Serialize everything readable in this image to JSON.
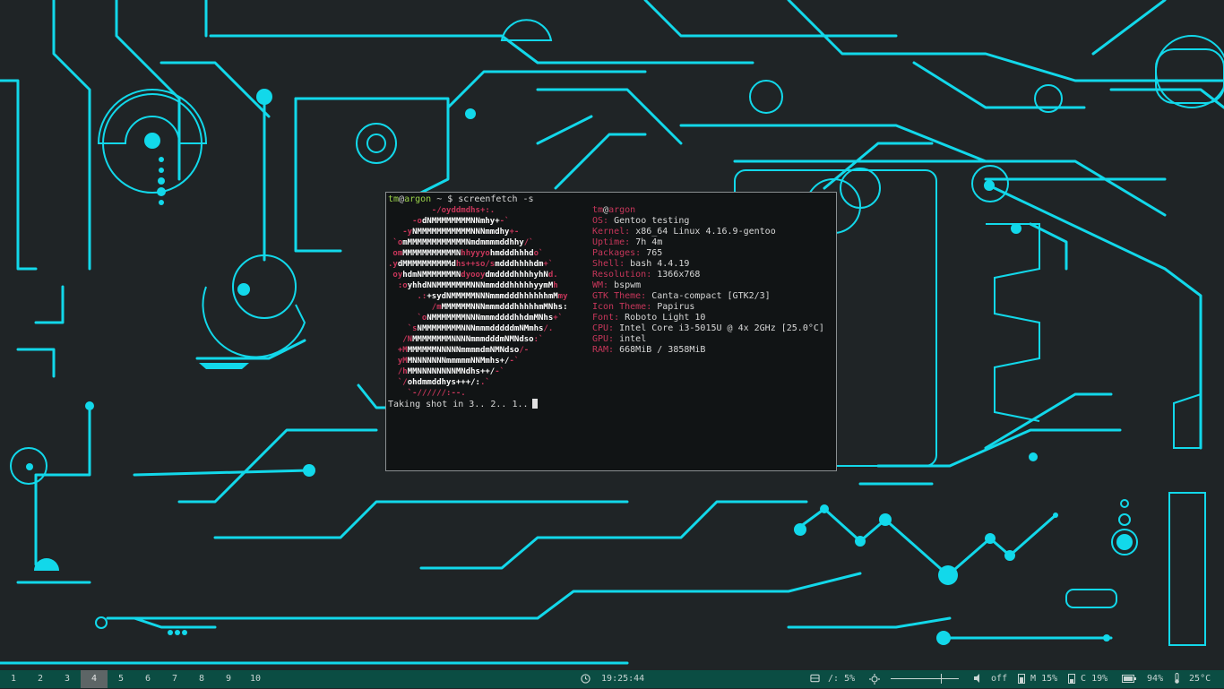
{
  "terminal": {
    "prompt_user": "tm",
    "prompt_at": "@",
    "prompt_host": "argon",
    "prompt_rest": " ~ $ screenfetch -s",
    "logo_lines": [
      [
        "         ",
        "-/oyddmdhs+:.",
        ""
      ],
      [
        "     ",
        "-o",
        "dNMMMMMMMMNNmhy+",
        "-`"
      ],
      [
        "   ",
        "-y",
        "NMMMMMMMMMMMNNNmmdhy",
        "+-"
      ],
      [
        " ",
        "`o",
        "mMMMMMMMMMMMMNmdmmmmddhhy",
        "/`"
      ],
      [
        " ",
        "om",
        "MMMMMMMMMMMN",
        "hhyyyo",
        "hmdddhhhd",
        "o`"
      ],
      [
        "",
        ".y",
        "dMMMMMMMMMMd",
        "hs++so/s",
        "mdddhhhhdm",
        "+`"
      ],
      [
        " ",
        "oy",
        "hdmNMMMMMMMN",
        "dyooy",
        "dmddddhhhhyhN",
        "d."
      ],
      [
        "  ",
        ":o",
        "yhhdNNMMMMMMMNNNmmdddhhhhhyymM",
        "h"
      ],
      [
        "      ",
        ".:",
        "+sydNMMMMMNNNmmmdddhhhhhhmM",
        "my"
      ],
      [
        "         ",
        "/m",
        "MMMMMMNNNmmmdddhhhhhmMNhs:",
        ""
      ],
      [
        "      ",
        "`o",
        "NMMMMMMMNNNmmmddddhhdmMNhs",
        "+`"
      ],
      [
        "    ",
        "`s",
        "NMMMMMMMMNNNmmmdddddmNMmhs",
        "/."
      ],
      [
        "   ",
        "/N",
        "MMMMMMMMNNNNmmmdddmNMNdso",
        ":`"
      ],
      [
        "  ",
        "+M",
        "MMMMMMNNNNNmmmmdmNMNdso",
        "/-"
      ],
      [
        "  ",
        "yM",
        "MNNNNNNNmmmmmNNMmhs+/",
        "-`"
      ],
      [
        "  ",
        "/h",
        "MMNNNNNNNNMNdhs++/",
        "-`"
      ],
      [
        "  ",
        "`/",
        "ohdmmddhys+++/:",
        ".`"
      ],
      [
        "    ",
        "`-//////:--.",
        "",
        ""
      ]
    ],
    "info_user": "tm",
    "info_at": "@",
    "info_host": "argon",
    "info": [
      {
        "key": "OS:",
        "value": "Gentoo testing"
      },
      {
        "key": "Kernel:",
        "value": "x86_64 Linux 4.16.9-gentoo"
      },
      {
        "key": "Uptime:",
        "value": "7h 4m"
      },
      {
        "key": "Packages:",
        "value": "765"
      },
      {
        "key": "Shell:",
        "value": "bash 4.4.19"
      },
      {
        "key": "Resolution:",
        "value": "1366x768"
      },
      {
        "key": "WM:",
        "value": "bspwm"
      },
      {
        "key": "GTK Theme:",
        "value": "Canta-compact [GTK2/3]"
      },
      {
        "key": "Icon Theme:",
        "value": "Papirus"
      },
      {
        "key": "Font:",
        "value": "Roboto Light 10"
      },
      {
        "key": "CPU:",
        "value": "Intel Core i3-5015U @ 4x 2GHz [25.0°C]"
      },
      {
        "key": "GPU:",
        "value": "intel"
      },
      {
        "key": "RAM:",
        "value": "668MiB / 3858MiB"
      }
    ],
    "shot_text": "Taking shot in 3.. 2.. 1.."
  },
  "bar": {
    "workspaces": [
      "1",
      "2",
      "3",
      "4",
      "5",
      "6",
      "7",
      "8",
      "9",
      "10"
    ],
    "active_workspace": "4",
    "clock": "19:25:44",
    "disk": "/: 5%",
    "volume": "off",
    "mem": "M 15%",
    "cpu": "C 19%",
    "battery": "94%",
    "temp": "25°C"
  },
  "colors": {
    "accent": "#1ee0f2",
    "background": "#1f2426",
    "bar": "#0b4d43",
    "logo_magenta": "#c6365a",
    "prompt_green": "#9bd34a"
  }
}
